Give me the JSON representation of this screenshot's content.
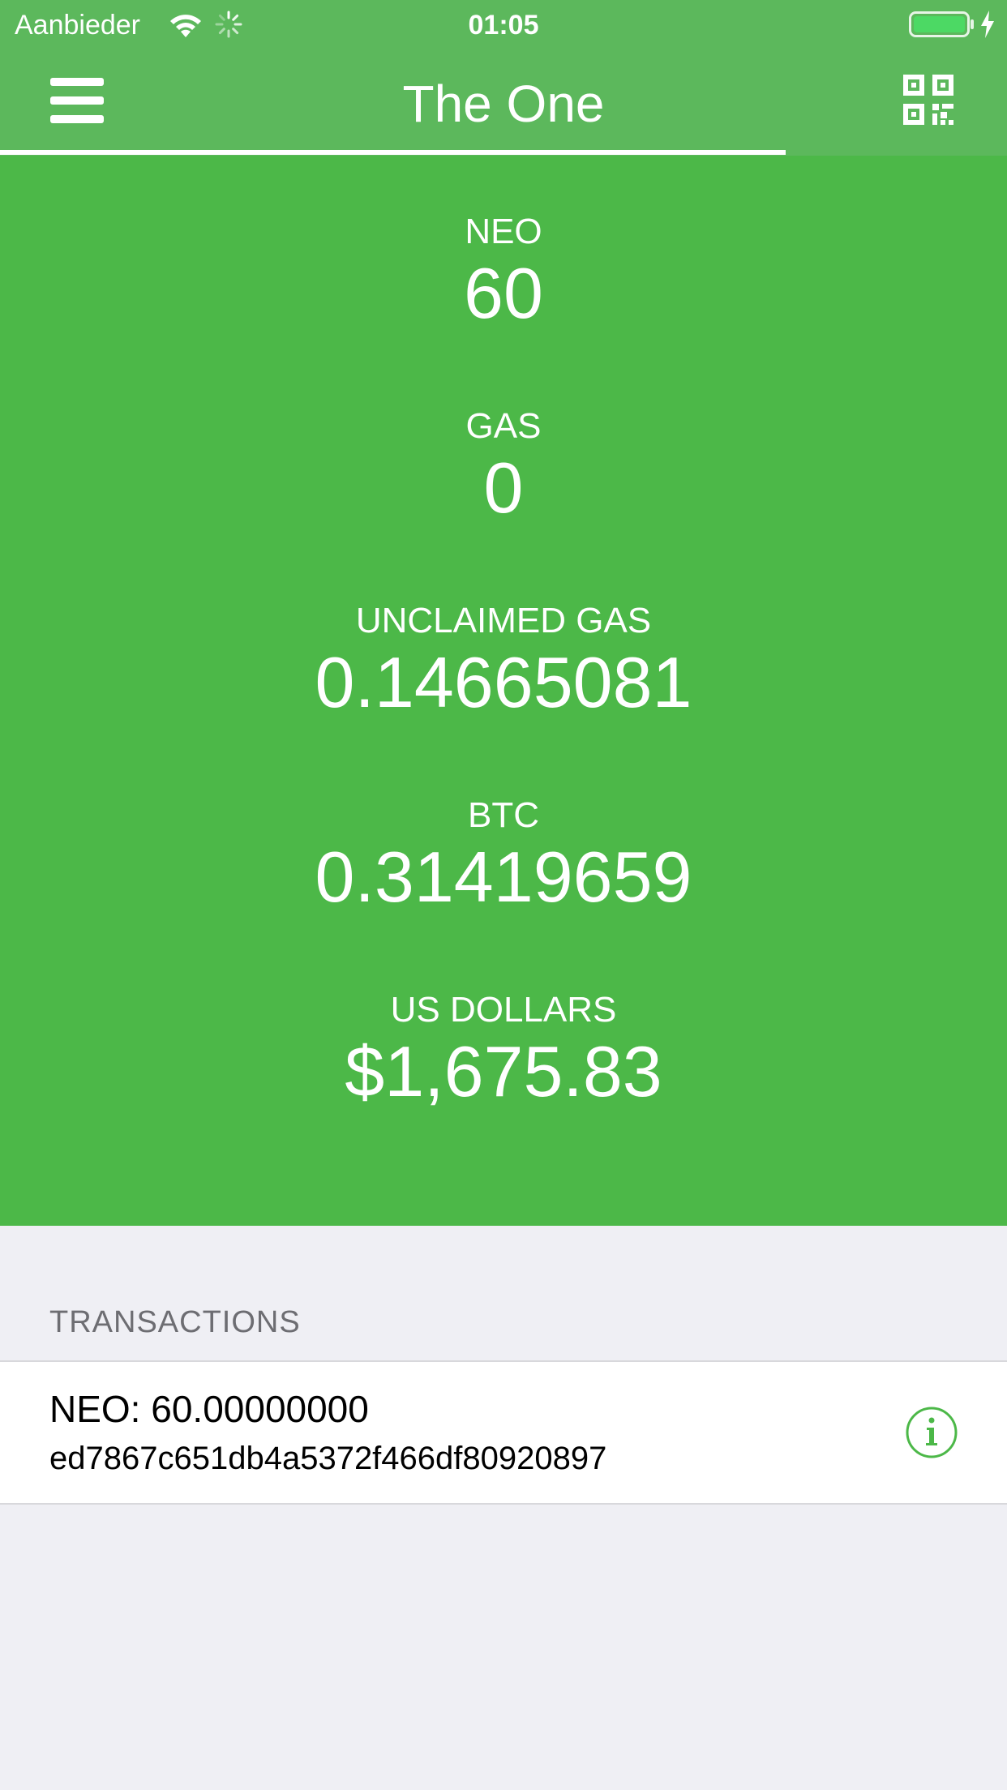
{
  "status_bar": {
    "carrier": "Aanbieder",
    "time": "01:05",
    "wifi_icon": "wifi-icon",
    "activity_icon": "activity-spinner-icon",
    "battery_icon": "battery-icon",
    "charging_icon": "charging-bolt-icon"
  },
  "nav": {
    "title": "The One",
    "menu_icon": "hamburger-menu-icon",
    "qr_icon": "qr-code-icon",
    "progress_fraction": 0.78
  },
  "balances": [
    {
      "label": "NEO",
      "value": "60"
    },
    {
      "label": "GAS",
      "value": "0"
    },
    {
      "label": "UNCLAIMED GAS",
      "value": "0.14665081"
    },
    {
      "label": "BTC",
      "value": "0.31419659"
    },
    {
      "label": "US DOLLARS",
      "value": "$1,675.83"
    }
  ],
  "transactions": {
    "header": "TRANSACTIONS",
    "items": [
      {
        "amount": "NEO: 60.00000000",
        "hash": "ed7867c651db4a5372f466df80920897",
        "info_icon": "info-icon"
      }
    ]
  },
  "colors": {
    "nav_green": "#5cb85c",
    "balance_green": "#4cb848",
    "background": "#efeff4",
    "info_icon": "#4cb848"
  }
}
